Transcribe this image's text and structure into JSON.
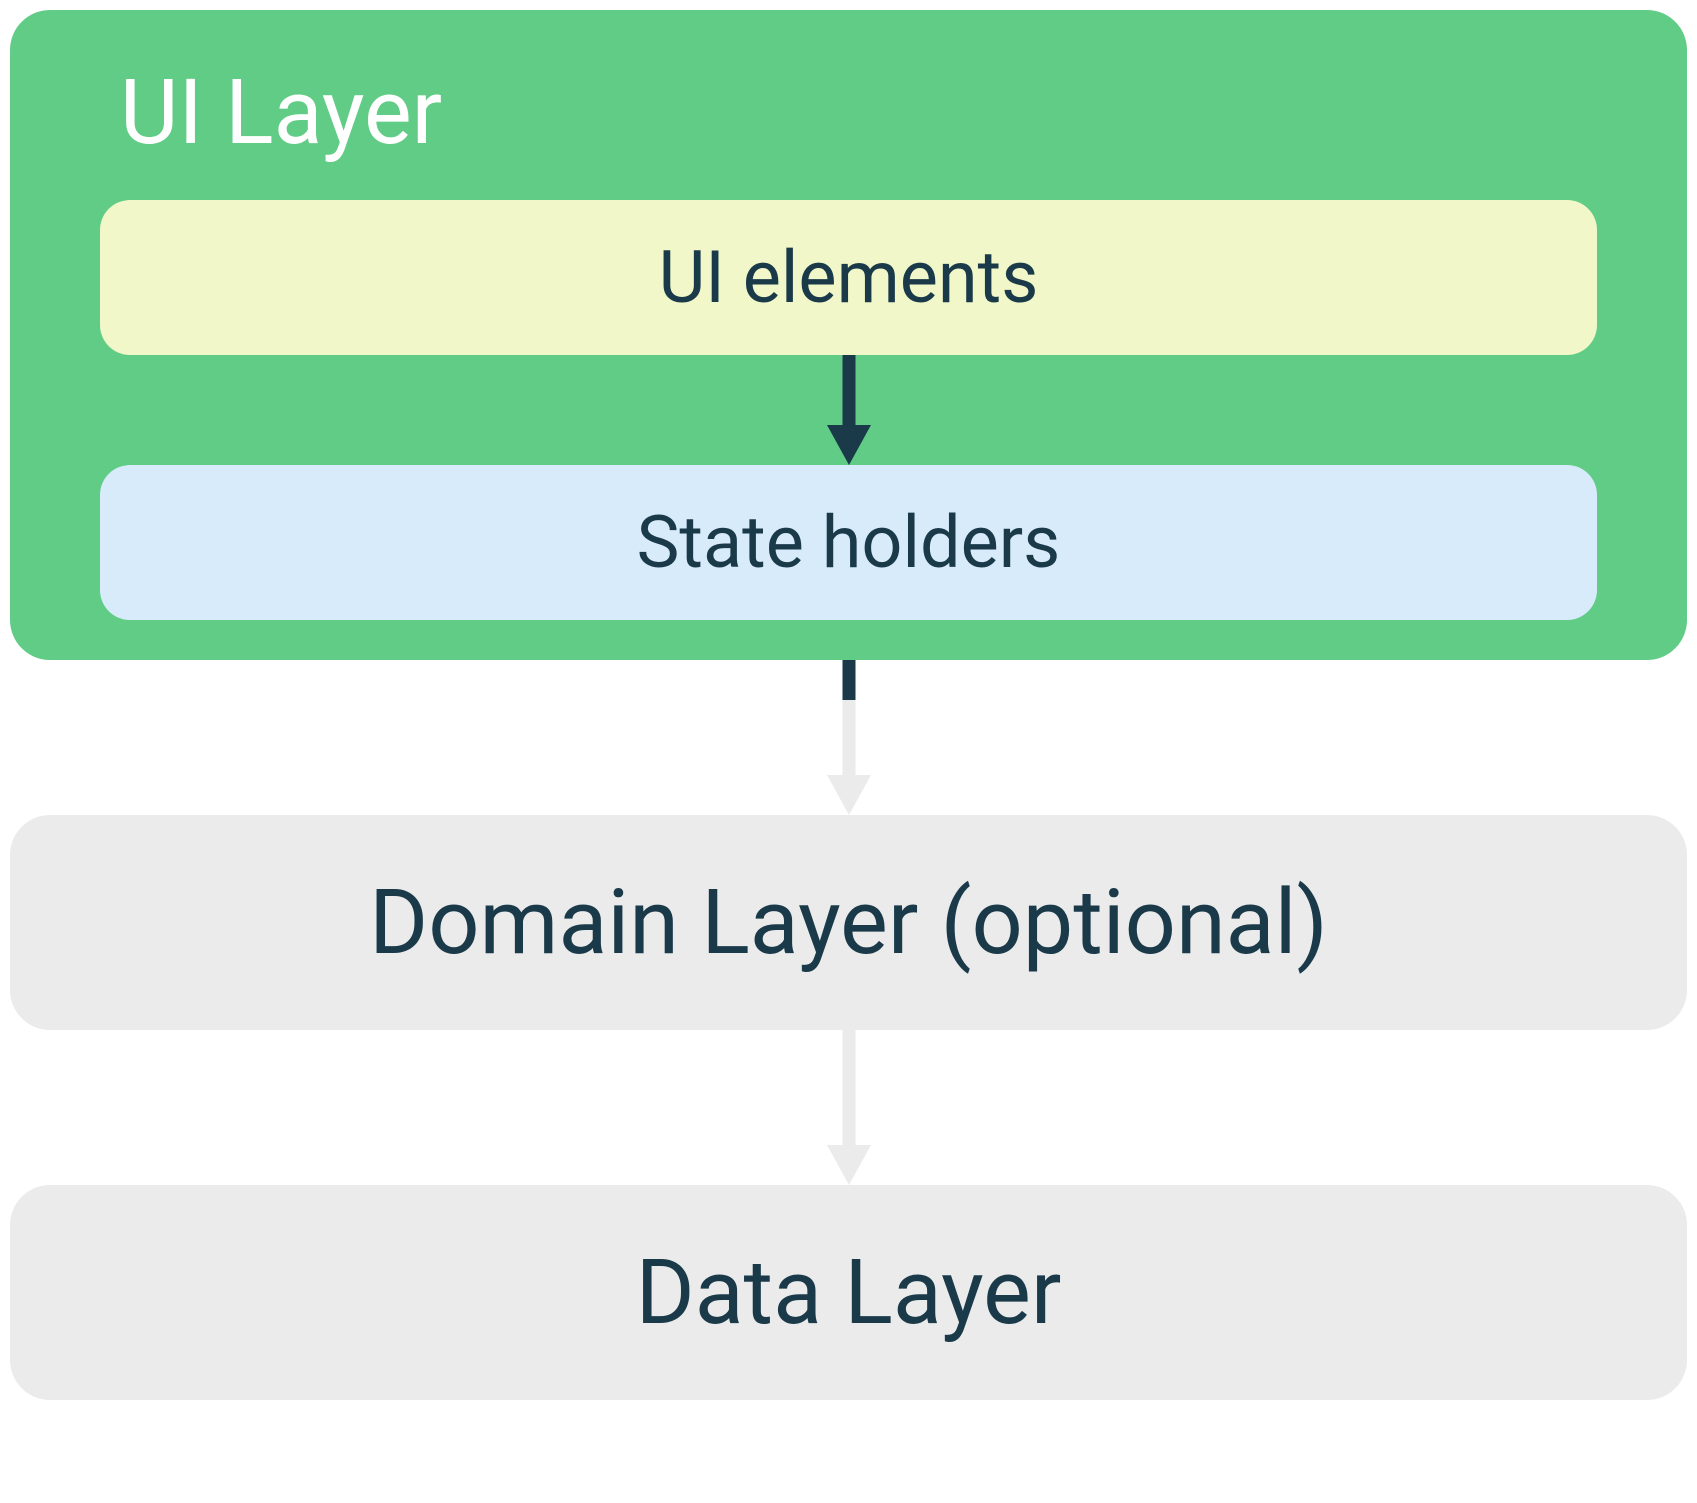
{
  "ui_layer": {
    "title": "UI Layer",
    "ui_elements_label": "UI elements",
    "state_holders_label": "State holders"
  },
  "domain_layer": {
    "label": "Domain Layer (optional)"
  },
  "data_layer": {
    "label": "Data Layer"
  },
  "colors": {
    "ui_layer_bg": "#61cc85",
    "ui_elements_bg": "#f1f7c8",
    "state_holders_bg": "#d8ebfa",
    "layer_box_bg": "#ebebeb",
    "text_dark": "#1a3a4a",
    "text_light": "#ffffff",
    "arrow_dark": "#1a3a4a",
    "arrow_light": "#ebebeb"
  }
}
